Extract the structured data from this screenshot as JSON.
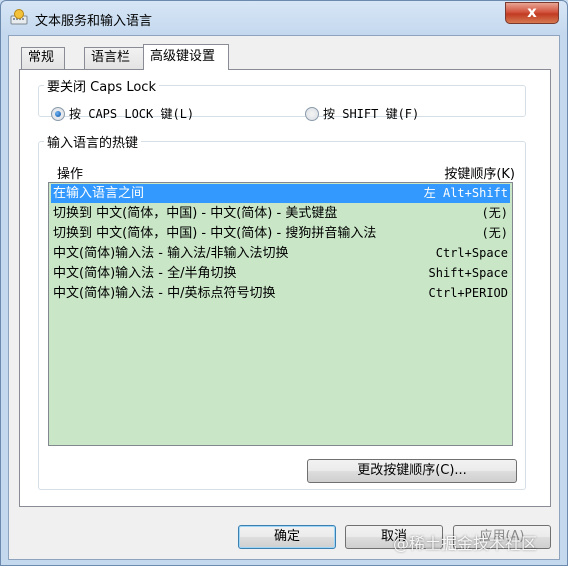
{
  "window": {
    "title": "文本服务和输入语言",
    "close_label": "x",
    "icon": "keyboard-globe-icon"
  },
  "tabs": [
    {
      "label": "常规",
      "active": false
    },
    {
      "label": "语言栏",
      "active": false
    },
    {
      "label": "高级键设置",
      "active": true
    }
  ],
  "caps_lock": {
    "legend": "要关闭 Caps Lock",
    "options": [
      {
        "label": "按 CAPS LOCK 键(L)",
        "selected": true
      },
      {
        "label": "按 SHIFT 键(F)",
        "selected": false
      }
    ]
  },
  "hotkeys": {
    "legend": "输入语言的热键",
    "col_action": "操作",
    "col_keys": "按键顺序(K)",
    "rows": [
      {
        "action": "在输入语言之间",
        "keys": "左 Alt+Shift",
        "selected": true
      },
      {
        "action": "切换到 中文(简体，中国) - 中文(简体) - 美式键盘",
        "keys": "(无)",
        "selected": false
      },
      {
        "action": "切换到 中文(简体，中国) - 中文(简体) - 搜狗拼音输入法",
        "keys": "(无)",
        "selected": false
      },
      {
        "action": "中文(简体)输入法 - 输入法/非输入法切换",
        "keys": "Ctrl+Space",
        "selected": false
      },
      {
        "action": "中文(简体)输入法 - 全/半角切换",
        "keys": "Shift+Space",
        "selected": false
      },
      {
        "action": "中文(简体)输入法 - 中/英标点符号切换",
        "keys": "Ctrl+PERIOD",
        "selected": false
      }
    ],
    "change_button": "更改按键顺序(C)..."
  },
  "footer": {
    "ok": "确定",
    "cancel": "取消",
    "apply": "应用(A)"
  },
  "watermark": "@稀土掘金技术社区",
  "colors": {
    "selection": "#3399ff",
    "list_bg": "#c9e6c7",
    "close": "#c13b22"
  }
}
